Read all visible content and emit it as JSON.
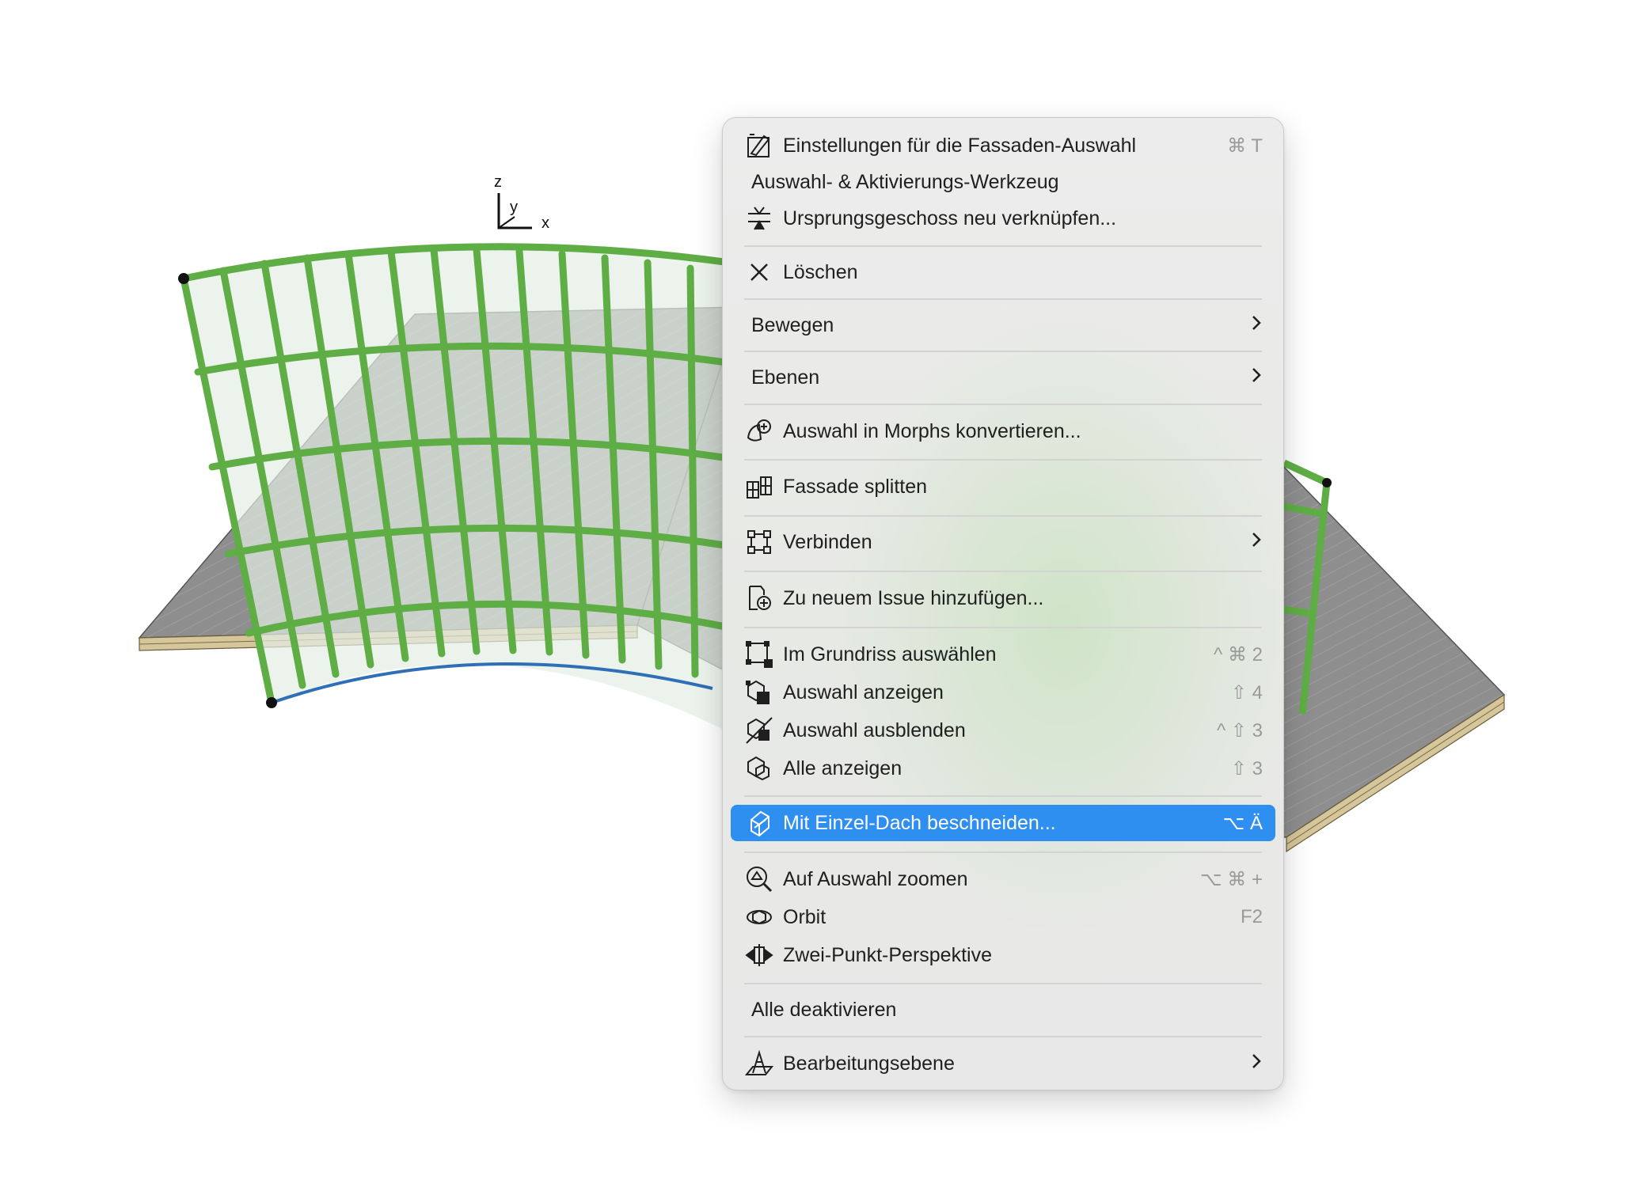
{
  "axis": {
    "z": "z",
    "y": "y",
    "x": "x"
  },
  "colors": {
    "highlight": "#2f8ff0",
    "facade_green": "#5fae45",
    "slab_gray": "#8d8d8d",
    "slab_wood": "#d8c9a0"
  },
  "menu": {
    "items": [
      {
        "label": "Einstellungen für die Fassaden-Auswahl",
        "shortcut": "⌘ T",
        "icon": "settings-icon"
      },
      {
        "label": "Auswahl- & Aktivierungs-Werkzeug"
      },
      {
        "label": "Ursprungsgeschoss neu verknüpfen...",
        "icon": "story-link-icon"
      },
      {
        "label": "Löschen",
        "icon": "close-icon"
      },
      {
        "label": "Bewegen"
      },
      {
        "label": "Ebenen"
      },
      {
        "label": "Auswahl in Morphs konvertieren...",
        "icon": "morph-icon"
      },
      {
        "label": "Fassade splitten",
        "icon": "facade-split-icon"
      },
      {
        "label": "Verbinden",
        "icon": "connect-icon"
      },
      {
        "label": "Zu neuem Issue hinzufügen...",
        "icon": "issue-add-icon"
      },
      {
        "label": "Im Grundriss auswählen",
        "shortcut": "^ ⌘ 2",
        "icon": "floorplan-select-icon"
      },
      {
        "label": "Auswahl anzeigen",
        "shortcut": "⇧ 4",
        "icon": "show-selection-icon"
      },
      {
        "label": "Auswahl ausblenden",
        "shortcut": "^ ⇧ 3",
        "icon": "hide-selection-icon"
      },
      {
        "label": "Alle anzeigen",
        "shortcut": "⇧ 3",
        "icon": "show-all-icon"
      },
      {
        "label": "Mit Einzel-Dach beschneiden...",
        "shortcut": "⌥ Ä",
        "icon": "trim-roof-icon"
      },
      {
        "label": "Auf Auswahl zoomen",
        "shortcut": "⌥ ⌘ +",
        "icon": "zoom-selection-icon"
      },
      {
        "label": "Orbit",
        "shortcut": "F2",
        "icon": "orbit-icon"
      },
      {
        "label": "Zwei-Punkt-Perspektive",
        "icon": "two-point-icon"
      },
      {
        "label": "Alle deaktivieren"
      },
      {
        "label": "Bearbeitungsebene",
        "icon": "edit-plane-icon"
      }
    ]
  }
}
